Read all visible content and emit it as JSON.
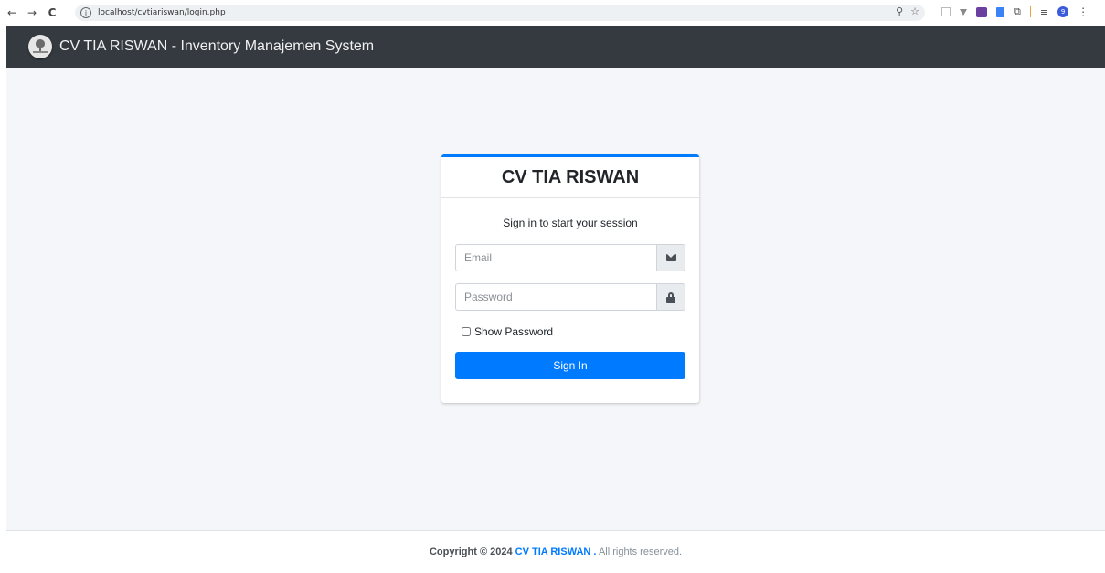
{
  "browser": {
    "back": "←",
    "forward": "→",
    "reload": "C",
    "url": "localhost/cvtiariswan/login.php",
    "profile_initial": "9"
  },
  "navbar": {
    "brand_text": "CV TIA RISWAN - Inventory Manajemen System"
  },
  "login": {
    "title": "CV TIA RISWAN",
    "message": "Sign in to start your session",
    "email_placeholder": "Email",
    "password_placeholder": "Password",
    "show_password_label": "Show Password",
    "sign_in_label": "Sign In"
  },
  "footer": {
    "copyright": "Copyright © 2024",
    "brand": "CV TIA RISWAN .",
    "rights": "All rights reserved."
  },
  "colors": {
    "navbar": "#343a40",
    "primary": "#007bff",
    "background": "#f4f6f9"
  }
}
